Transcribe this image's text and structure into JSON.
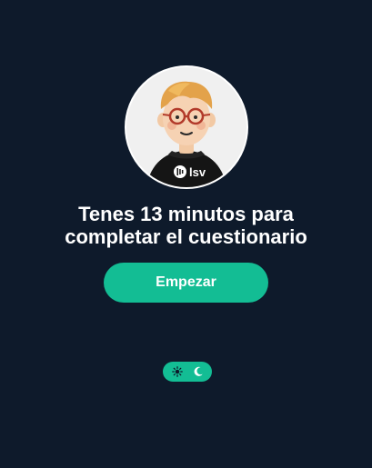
{
  "avatar": {
    "icon": "developer-avatar",
    "shirt_logo_text": "lsv"
  },
  "quiz": {
    "title": "Tenes 13 minutos para completar el cuestionario",
    "start_button": "Empezar"
  },
  "theme_toggle": {
    "light_icon": "sun-icon",
    "dark_icon": "moon-icon",
    "active": "dark"
  },
  "colors": {
    "background": "#0e1a2b",
    "accent": "#13bd94",
    "text": "#ffffff"
  }
}
